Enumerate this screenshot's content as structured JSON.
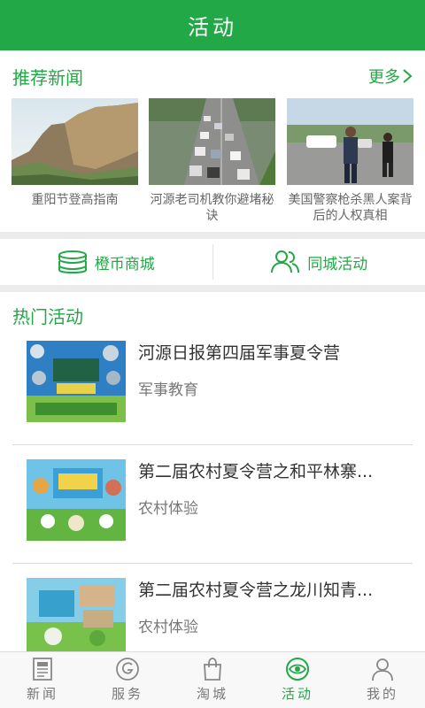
{
  "header": {
    "title": "活动"
  },
  "recommend": {
    "title": "推荐新闻",
    "more_label": "更多",
    "items": [
      {
        "caption": "重阳节登高指南"
      },
      {
        "caption": "河源老司机教你避堵秘诀"
      },
      {
        "caption": "美国警察枪杀黑人案背后的人权真相"
      }
    ]
  },
  "quick_links": [
    {
      "label": "橙币商城",
      "icon": "coins-icon"
    },
    {
      "label": "同城活动",
      "icon": "people-icon"
    }
  ],
  "hot": {
    "title": "热门活动",
    "items": [
      {
        "title": "河源日报第四届军事夏令营",
        "tag": "军事教育"
      },
      {
        "title": "第二届农村夏令营之和平林寨...",
        "tag": "农村体验"
      },
      {
        "title": "第二届农村夏令营之龙川知青...",
        "tag": "农村体验"
      }
    ]
  },
  "tabbar": {
    "active": "活动",
    "tabs": [
      {
        "label": "新闻",
        "icon": "newspaper-icon"
      },
      {
        "label": "服务",
        "icon": "service-icon"
      },
      {
        "label": "淘城",
        "icon": "shopping-bag-icon"
      },
      {
        "label": "活动",
        "icon": "activity-eye-icon"
      },
      {
        "label": "我的",
        "icon": "user-icon"
      }
    ]
  },
  "colors": {
    "brand": "#22a846",
    "text": "#333333",
    "muted": "#777777"
  }
}
